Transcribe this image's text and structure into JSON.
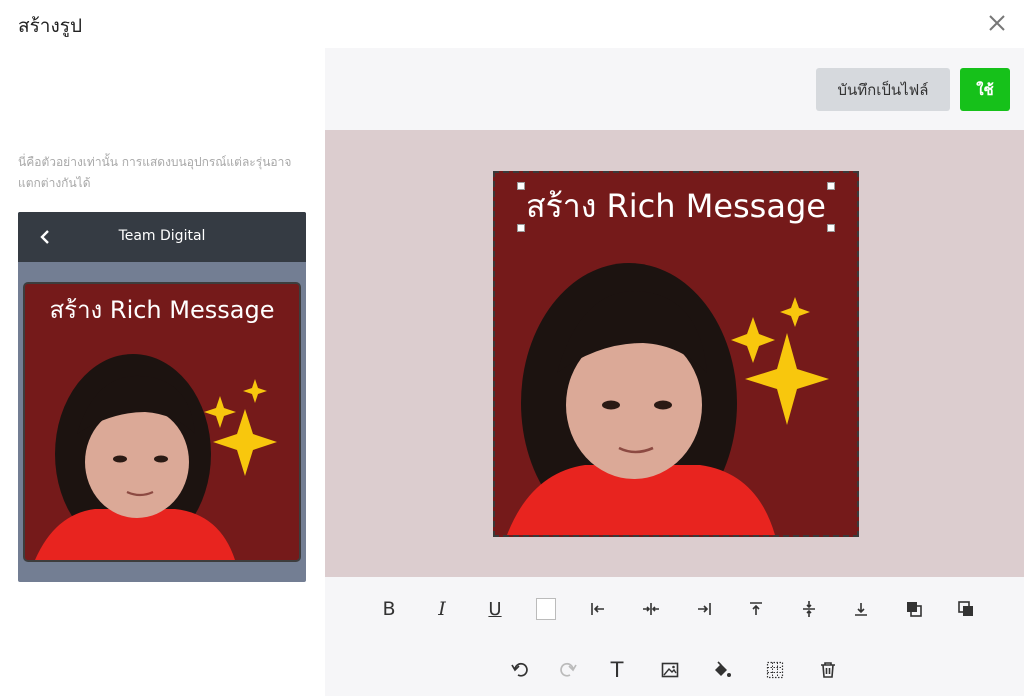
{
  "window": {
    "title": "สร้างรูป"
  },
  "preview": {
    "note": "นี่คือตัวอย่างเท่านั้น การแสดงบนอุปกรณ์แต่ละรุ่นอาจแตกต่างกันได้",
    "chat_name": "Team Digital",
    "message_text": "สร้าง Rich Message"
  },
  "actions": {
    "save_label": "บันทึกเป็นไฟล์",
    "use_label": "ใช้"
  },
  "canvas": {
    "text": "สร้าง Rich Message"
  },
  "colors": {
    "accent_green": "#16c11a",
    "canvas_bg": "#751a1a",
    "work_bg": "#dccdcf",
    "sparkle": "#f8c70d"
  },
  "toolbar": {
    "row1": [
      "bold-icon",
      "italic-icon",
      "underline-icon",
      "text-color-swatch",
      "align-left-icon",
      "align-center-icon",
      "align-right-icon",
      "align-top-icon",
      "align-middle-icon",
      "align-bottom-icon",
      "bring-forward-icon",
      "send-backward-icon"
    ],
    "row2": [
      "undo-icon",
      "redo-icon",
      "add-text-icon",
      "add-image-icon",
      "fill-color-icon",
      "grid-icon",
      "delete-icon"
    ],
    "bold": "B",
    "italic": "I",
    "underline": "U",
    "text": "T"
  }
}
